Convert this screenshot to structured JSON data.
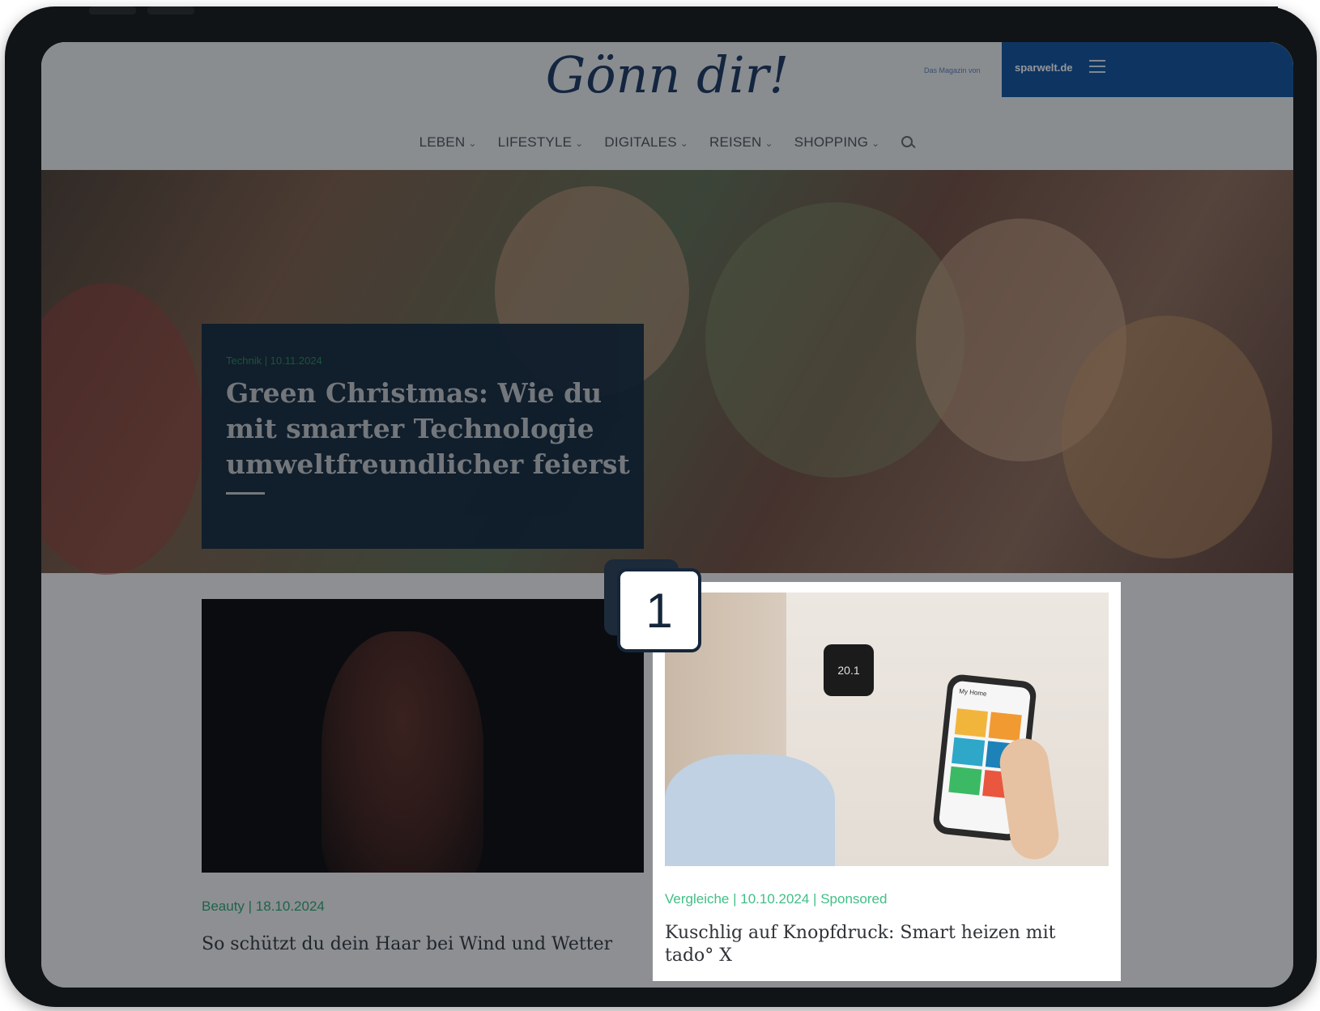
{
  "site": {
    "logo": "Gönn dir!",
    "partner_label": "Das Magazin von",
    "partner_name": "sparwelt.de"
  },
  "nav": {
    "items": [
      {
        "label": "LEBEN"
      },
      {
        "label": "LIFESTYLE"
      },
      {
        "label": "DIGITALES"
      },
      {
        "label": "REISEN"
      },
      {
        "label": "SHOPPING"
      }
    ]
  },
  "hero": {
    "meta": "Technik | 10.11.2024",
    "title": "Green Christmas: Wie du mit smarter Technologie umweltfreundlicher feierst"
  },
  "cards": [
    {
      "meta": "Beauty | 18.10.2024",
      "title": "So schützt du dein Haar bei Wind und Wetter"
    },
    {
      "meta": "Vergleiche | 10.10.2024 | Sponsored",
      "title": "Kuschlig auf Knopfdruck: Smart heizen mit tado° X",
      "thermostat_reading": "20.1",
      "phone_heading": "My Home"
    }
  ],
  "marker": {
    "label": "1"
  },
  "colors": {
    "navy": "#16325c",
    "partner_blue": "#0b4f9c",
    "meta_green": "#3fbf86",
    "hero_card": "#0c2238"
  },
  "icons": [
    "chevron-down-icon",
    "search-icon",
    "menu-icon"
  ]
}
